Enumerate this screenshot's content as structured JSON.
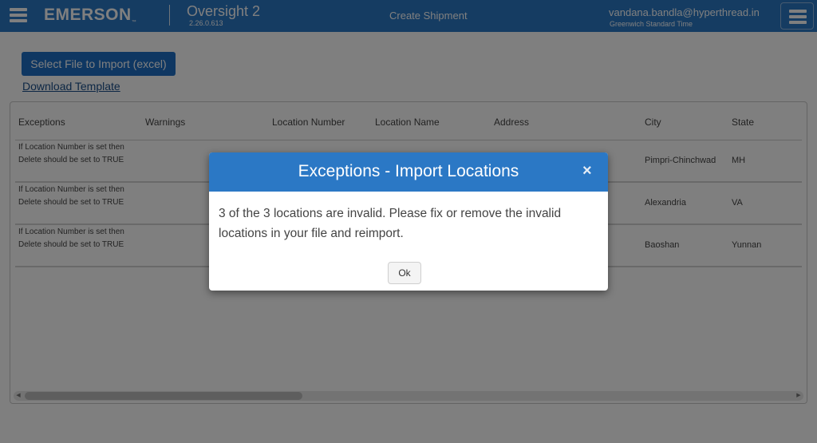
{
  "header": {
    "logo": "EMERSON",
    "logo_tm": "™",
    "app_name": "Oversight 2",
    "version": "2.26.0.613",
    "page_heading": "Create Shipment",
    "user_email": "vandana.bandla@hyperthread.in",
    "timezone": "Greenwich Standard Time"
  },
  "actions": {
    "select_file": "Select File to Import (excel)",
    "download_template": "Download Template"
  },
  "table": {
    "columns": [
      "Exceptions",
      "Warnings",
      "Location Number",
      "Location Name",
      "Address",
      "City",
      "State"
    ],
    "rows": [
      {
        "exception": "If Location Number is set then Delete should be set to TRUE",
        "warnings": "",
        "location_number": "",
        "location_name": "",
        "address": "",
        "city": "Pimpri-Chinchwad",
        "state": "MH"
      },
      {
        "exception": "If Location Number is set then Delete should be set to TRUE",
        "warnings": "",
        "location_number": "",
        "location_name": "",
        "address": "",
        "city": "Alexandria",
        "state": "VA"
      },
      {
        "exception": "If Location Number is set then Delete should be set to TRUE",
        "warnings": "",
        "location_number": "",
        "location_name": "",
        "address": "",
        "city": "Baoshan",
        "state": "Yunnan"
      }
    ]
  },
  "modal": {
    "title": "Exceptions - Import Locations",
    "close": "×",
    "message": "3 of the 3 locations are invalid. Please fix or remove the invalid locations in your file and reimport.",
    "ok_label": "Ok"
  },
  "colors": {
    "brand_blue": "#2b78c5",
    "button_blue": "#1f6fc5",
    "link": "#1b4f8a"
  }
}
